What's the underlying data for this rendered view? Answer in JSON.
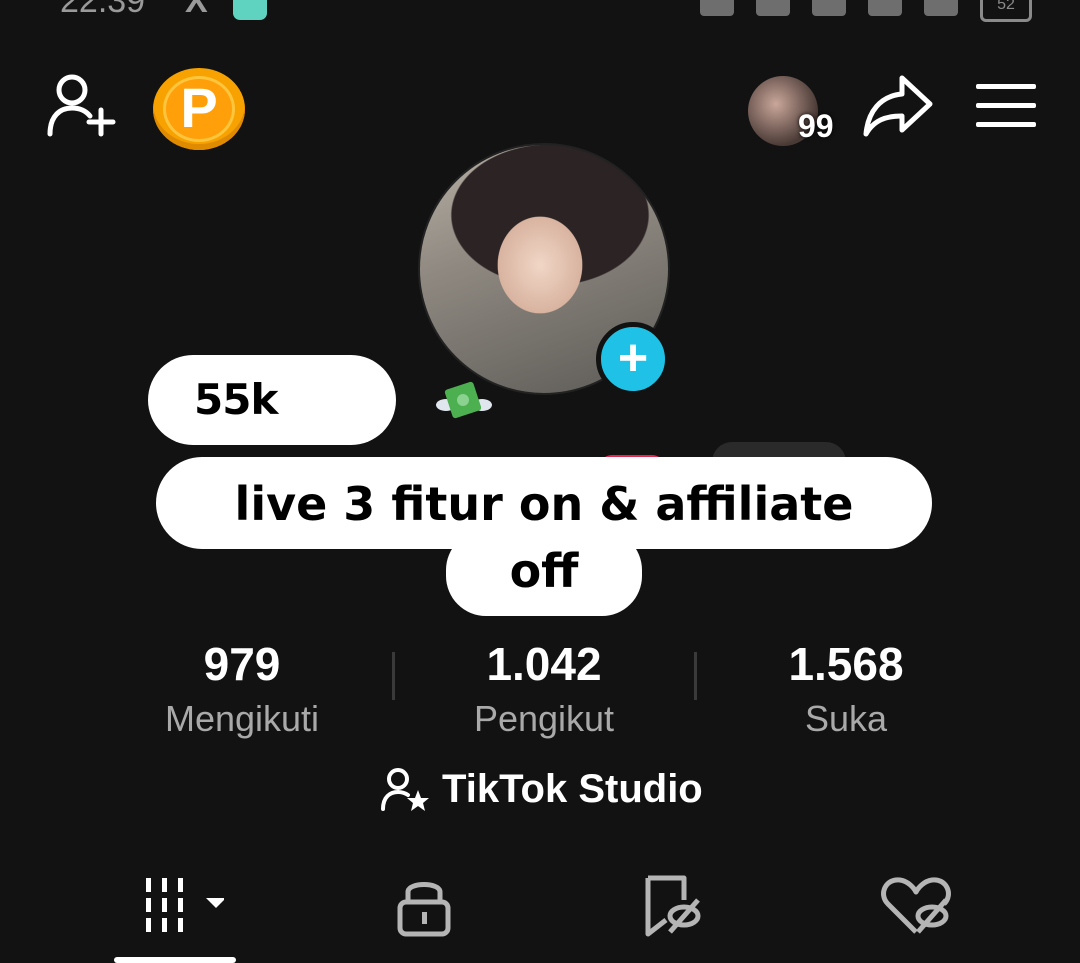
{
  "status_bar": {
    "time": "22.39",
    "x_app": "X",
    "battery": "52"
  },
  "top_bar": {
    "friends_count": "99",
    "coin_letter": "P"
  },
  "overlay": {
    "price": "55k",
    "description_line1": "live 3 fitur on & affiliate",
    "description_line2": "off"
  },
  "stats": [
    {
      "value": "979",
      "label": "Mengikuti"
    },
    {
      "value": "1.042",
      "label": "Pengikut"
    },
    {
      "value": "1.568",
      "label": "Suka"
    }
  ],
  "studio": {
    "label": "TikTok Studio"
  },
  "tabs": [
    {
      "icon": "grid-icon",
      "selected": true
    },
    {
      "icon": "lock-icon",
      "selected": false
    },
    {
      "icon": "bookmark-hidden-icon",
      "selected": false
    },
    {
      "icon": "heart-hidden-icon",
      "selected": false
    }
  ],
  "colors": {
    "background": "#121212",
    "accent_add": "#1fc2e6",
    "coin": "#ff9f0a"
  }
}
